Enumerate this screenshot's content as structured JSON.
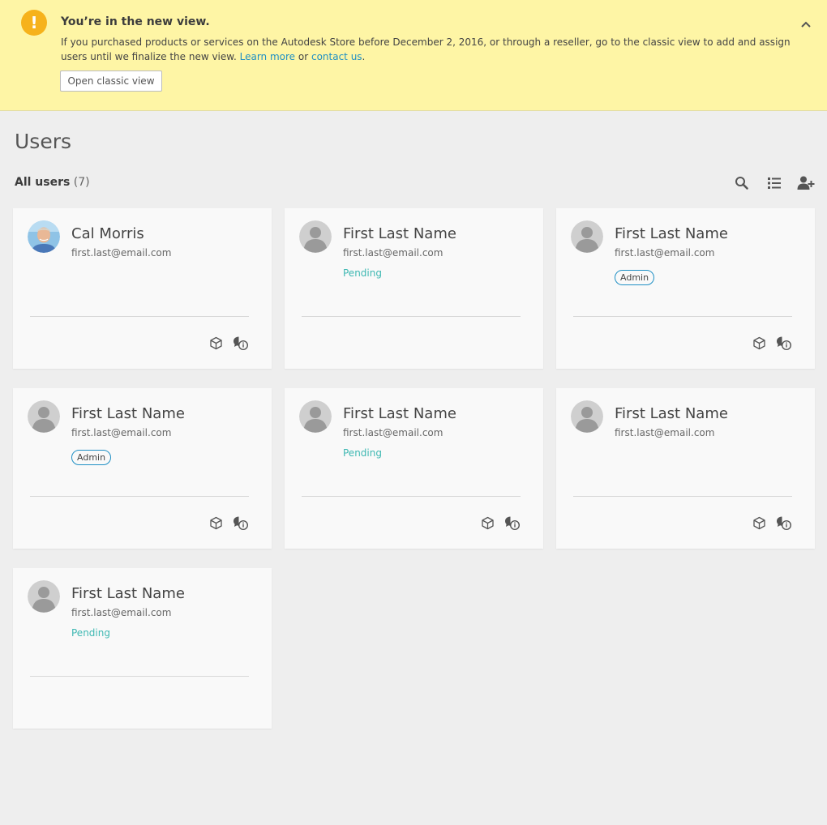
{
  "banner": {
    "title": "You’re in the new view.",
    "text_pre": "If you purchased products or services on the Autodesk Store before December 2, 2016, or through a reseller, go to the classic view to add and assign users until we finalize the new view. ",
    "learn_more": "Learn more",
    "or": " or ",
    "contact_us": "contact us",
    "period": ".",
    "button_label": "Open classic view",
    "icon": "exclamation-icon",
    "collapse_icon": "chevron-up-icon",
    "background": "#fef5a5",
    "accent": "#f6b21b"
  },
  "page": {
    "title": "Users",
    "filter_label": "All users",
    "filter_count": "(7)"
  },
  "toolbar": {
    "icons": [
      "search-icon",
      "list-view-icon",
      "add-user-icon"
    ]
  },
  "users": [
    {
      "name": "Cal Morris",
      "email": "first.last@email.com",
      "status": "",
      "role": "",
      "photo": true,
      "icons": true
    },
    {
      "name": "First Last Name",
      "email": "first.last@email.com",
      "status": "Pending",
      "role": "",
      "photo": false,
      "icons": false
    },
    {
      "name": "First Last Name",
      "email": "first.last@email.com",
      "status": "",
      "role": "Admin",
      "photo": false,
      "icons": true
    },
    {
      "name": "First Last Name",
      "email": "first.last@email.com",
      "status": "",
      "role": "Admin",
      "photo": false,
      "icons": true
    },
    {
      "name": "First Last Name",
      "email": "first.last@email.com",
      "status": "Pending",
      "role": "",
      "photo": false,
      "icons": true
    },
    {
      "name": "First Last Name",
      "email": "first.last@email.com",
      "status": "",
      "role": "",
      "photo": false,
      "icons": true
    },
    {
      "name": "First Last Name",
      "email": "first.last@email.com",
      "status": "Pending",
      "role": "",
      "photo": false,
      "icons": false
    }
  ],
  "colors": {
    "pending": "#3eb8b2",
    "admin_border": "#1f8fc4",
    "link": "#1f8fc4",
    "background": "#eeeeee",
    "card": "#f9f9f9"
  }
}
